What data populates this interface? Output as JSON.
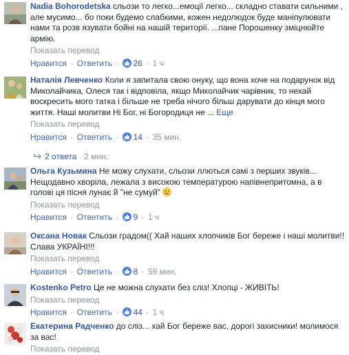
{
  "comments": [
    {
      "name": "Nadia Bohorodetska",
      "text": "сльози то легко...емоції легко... складно ставати сильними , але мусимо... бо поки будемо слабкими, кожен недолюдок буде маніпулювати нами та розв язувати бойні на нашій території. ...пане Порошенку зміцнюйте армію.",
      "translate": "Показать перевод",
      "like": "Нравится",
      "reply": "Ответить",
      "likes": "26",
      "time": "1 ч"
    },
    {
      "name": "Наталія Левченко",
      "text": "Коли я запитала свою онуку, що вона хоче на подарунок від Миколайчика, Олеся так і відповіла, якщо Миколайчик чарівник, то нехай воскресить мого татка і більше не треба нічого більш дарувати до кінця мого життя. Наші молитви Ні Бог, ні Богородиця не ...",
      "more": "Еще",
      "translate": "Показать перевод",
      "like": "Нравится",
      "reply": "Ответить",
      "likes": "14",
      "time": "35 мин."
    },
    {
      "name": "Ольга Кузьмина",
      "text": "Не можу слухати, сльози ллються самі з перших звуків... Нещодавно хворіла, лежала з високою температурою напівнепритомна, а в голові ця пісня лунає й \"не сумуй\"",
      "translate": "Показать перевод",
      "like": "Нравится",
      "reply": "Ответить",
      "likes": "9",
      "time": "1 ч"
    },
    {
      "name": "Оксана Новак",
      "text": "Сльози градом(( Хай наших хлопчиків Бог береже і наші молитви!! Слава УКРАЇНІ!!!",
      "translate": "Показать перевод",
      "like": "Нравится",
      "reply": "Ответить",
      "likes": "8",
      "time": "59 мин."
    },
    {
      "name": "Kostenko Petro",
      "text": "Це не можна слухати без сліз! Хлопці - ЖИВІТЬ!",
      "translate": "Показать перевод",
      "like": "Нравится",
      "reply": "Ответить",
      "likes": "44",
      "time": "1 ч"
    },
    {
      "name": "Екатерина Радченко",
      "text": "до сліз... хай Бог береже вас, дорогі захисники! молимося за вас!",
      "translate": "Показать перевод"
    }
  ],
  "replies": {
    "label": "2 ответа",
    "time": "2 мин."
  },
  "separator": "·",
  "colors": {
    "name": "#365899",
    "muted": "#90949c",
    "link": "#4267b2",
    "like_badge": "#4c7cd8"
  }
}
